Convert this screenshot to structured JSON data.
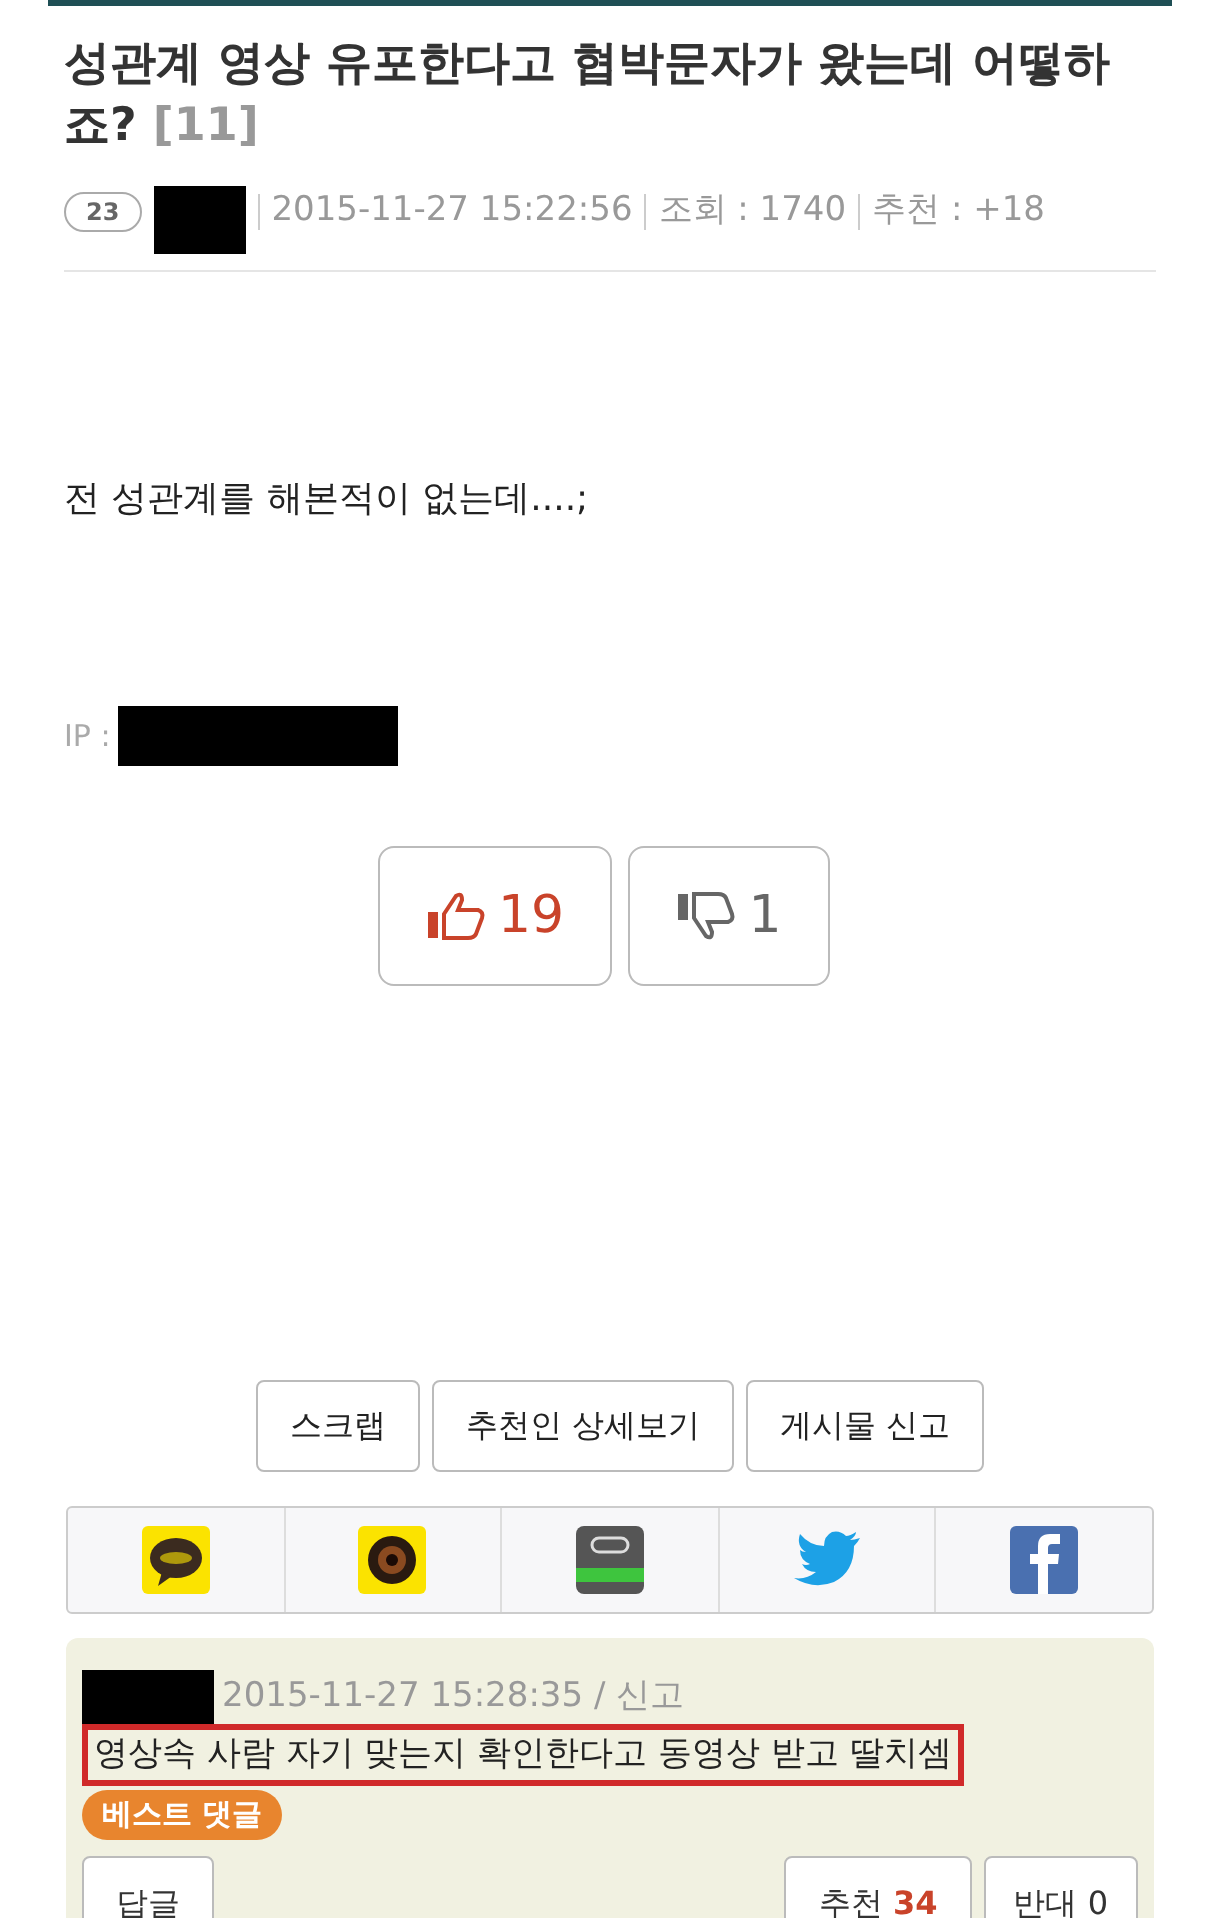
{
  "post": {
    "title": "성관계 영상 유포한다고 협박문자가 왔는데 어떻하죠?",
    "comment_count": "[11]",
    "level_badge": "23",
    "date": "2015-11-27 15:22:56",
    "views_label": "조회 : 1740",
    "recommend_label": "추천 : +18",
    "body": "전 성관계를 해본적이 없는데....;",
    "ip_label": "IP :"
  },
  "votes": [
    {
      "kind": "up",
      "count": "19"
    },
    {
      "kind": "down",
      "count": "1"
    }
  ],
  "actions": [
    "스크랩",
    "추천인 상세보기",
    "게시물 신고"
  ],
  "share": [
    {
      "kind": "talk"
    },
    {
      "kind": "story"
    },
    {
      "kind": "band"
    },
    {
      "kind": "twitter"
    },
    {
      "kind": "facebook"
    }
  ],
  "comment": {
    "meta": "2015-11-27 15:28:35 / 신고",
    "text": "영상속 사람 자기 맞는지 확인한다고 동영상 받고 딸치셈",
    "badge": "베스트 댓글",
    "reply": "답글",
    "recommend": "추천",
    "recommend_count": "34",
    "oppose": "반대 0"
  }
}
